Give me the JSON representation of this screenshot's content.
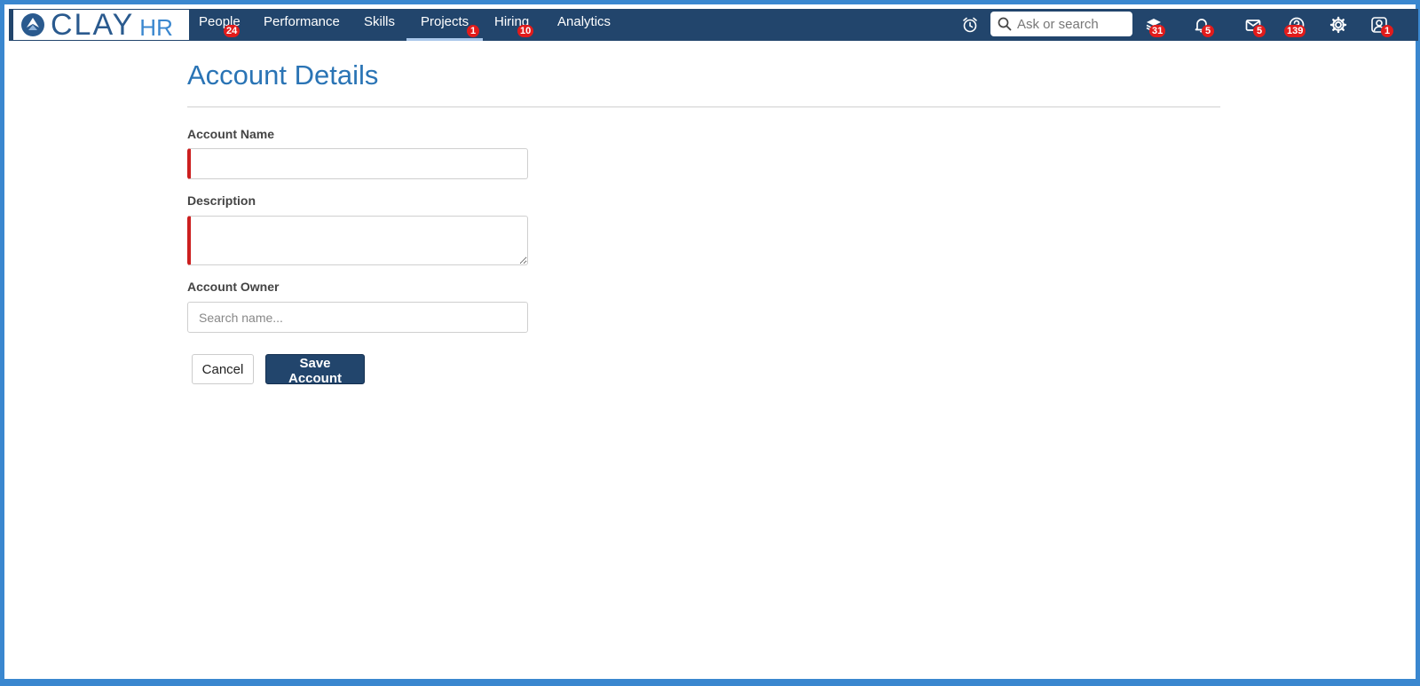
{
  "brand": {
    "name": "CLAY",
    "suffix": "HR"
  },
  "nav": [
    {
      "label": "People",
      "badge": "24"
    },
    {
      "label": "Performance",
      "badge": null
    },
    {
      "label": "Skills",
      "badge": null
    },
    {
      "label": "Projects",
      "badge": "1",
      "active": true
    },
    {
      "label": "Hiring",
      "badge": "10"
    },
    {
      "label": "Analytics",
      "badge": null
    }
  ],
  "search": {
    "placeholder": "Ask or search"
  },
  "toolbar_badges": {
    "learning": "31",
    "notifications": "5",
    "messages": "5",
    "help": "139",
    "profile": "1"
  },
  "form": {
    "title": "Account Details",
    "account_name_label": "Account Name",
    "account_name_value": "",
    "description_label": "Description",
    "description_value": "",
    "owner_label": "Account Owner",
    "owner_placeholder": "Search name...",
    "cancel_label": "Cancel",
    "save_label": "Save Account"
  },
  "colors": {
    "topbar": "#22456c",
    "frame": "#3a87cf",
    "title": "#2a74b5",
    "required_marker": "#cc1f1f",
    "badge": "#e21b1b"
  }
}
